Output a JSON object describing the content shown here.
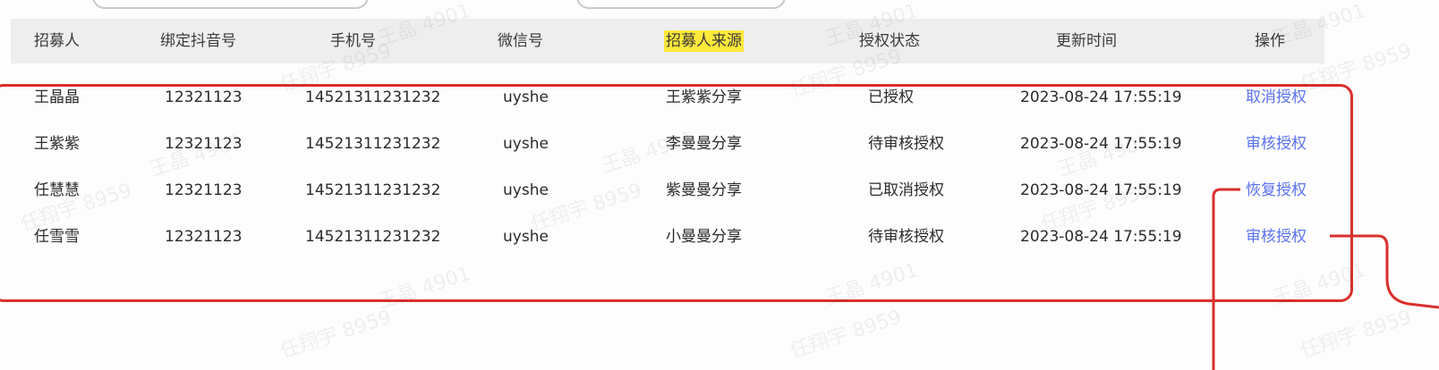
{
  "columns": [
    "招募人",
    "绑定抖音号",
    "手机号",
    "微信号",
    "招募人来源",
    "授权状态",
    "更新时间",
    "操作"
  ],
  "rows": [
    {
      "recruiter": "王晶晶",
      "douyin": "12321123",
      "phone": "14521311231232",
      "wechat": "uyshe",
      "source": "王紫紫分享",
      "status": "已授权",
      "updated": "2023-08-24 17:55:19",
      "action": "取消授权"
    },
    {
      "recruiter": "王紫紫",
      "douyin": "12321123",
      "phone": "14521311231232",
      "wechat": "uyshe",
      "source": "李曼曼分享",
      "status": "待审核授权",
      "updated": "2023-08-24 17:55:19",
      "action": "审核授权"
    },
    {
      "recruiter": "任慧慧",
      "douyin": "12321123",
      "phone": "14521311231232",
      "wechat": "uyshe",
      "source": "紫曼曼分享",
      "status": "已取消授权",
      "updated": "2023-08-24 17:55:19",
      "action": "恢复授权"
    },
    {
      "recruiter": "任雪雪",
      "douyin": "12321123",
      "phone": "14521311231232",
      "wechat": "uyshe",
      "source": "小曼曼分享",
      "status": "待审核授权",
      "updated": "2023-08-24 17:55:19",
      "action": "审核授权"
    }
  ],
  "watermarks": [
    "王晶 4901",
    "任翔宇 8959"
  ],
  "colors": {
    "header_bg": "#eeeeee",
    "highlight": "#ffe93a",
    "action_link": "#5b72f0",
    "annotation_red": "#d9302c"
  }
}
